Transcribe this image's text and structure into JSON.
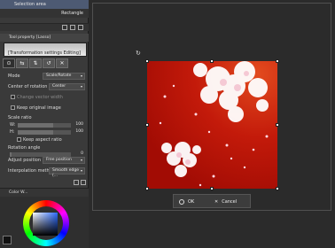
{
  "layers": {
    "selection_area": "Selection area",
    "rectangle": "Rectangle"
  },
  "tool_property": {
    "header": "Tool property [Lasso]",
    "sub_tool_preview_text": "[Transformation settings Editing]"
  },
  "transform": {
    "mode_label": "Mode",
    "mode_value": "Scale/Rotate",
    "center_label": "Center of rotation",
    "center_value": "Center",
    "change_vector_width": "Change vector width",
    "keep_original_image": "Keep original image",
    "scale_ratio_label": "Scale ratio",
    "w_label": "W:",
    "w_value": "100",
    "h_label": "H:",
    "h_value": "100",
    "keep_aspect_ratio": "Keep aspect ratio",
    "rotation_angle_label": "Rotation angle",
    "rotation_angle_value": "0",
    "adjust_position_label": "Adjust position",
    "adjust_position_value": "Free position",
    "interpolation_label": "Interpolation method",
    "interpolation_value": "Smooth edge (..."
  },
  "color_panel": {
    "header": "Color W..."
  },
  "dialog": {
    "ok_label": "OK",
    "cancel_label": "Cancel"
  }
}
